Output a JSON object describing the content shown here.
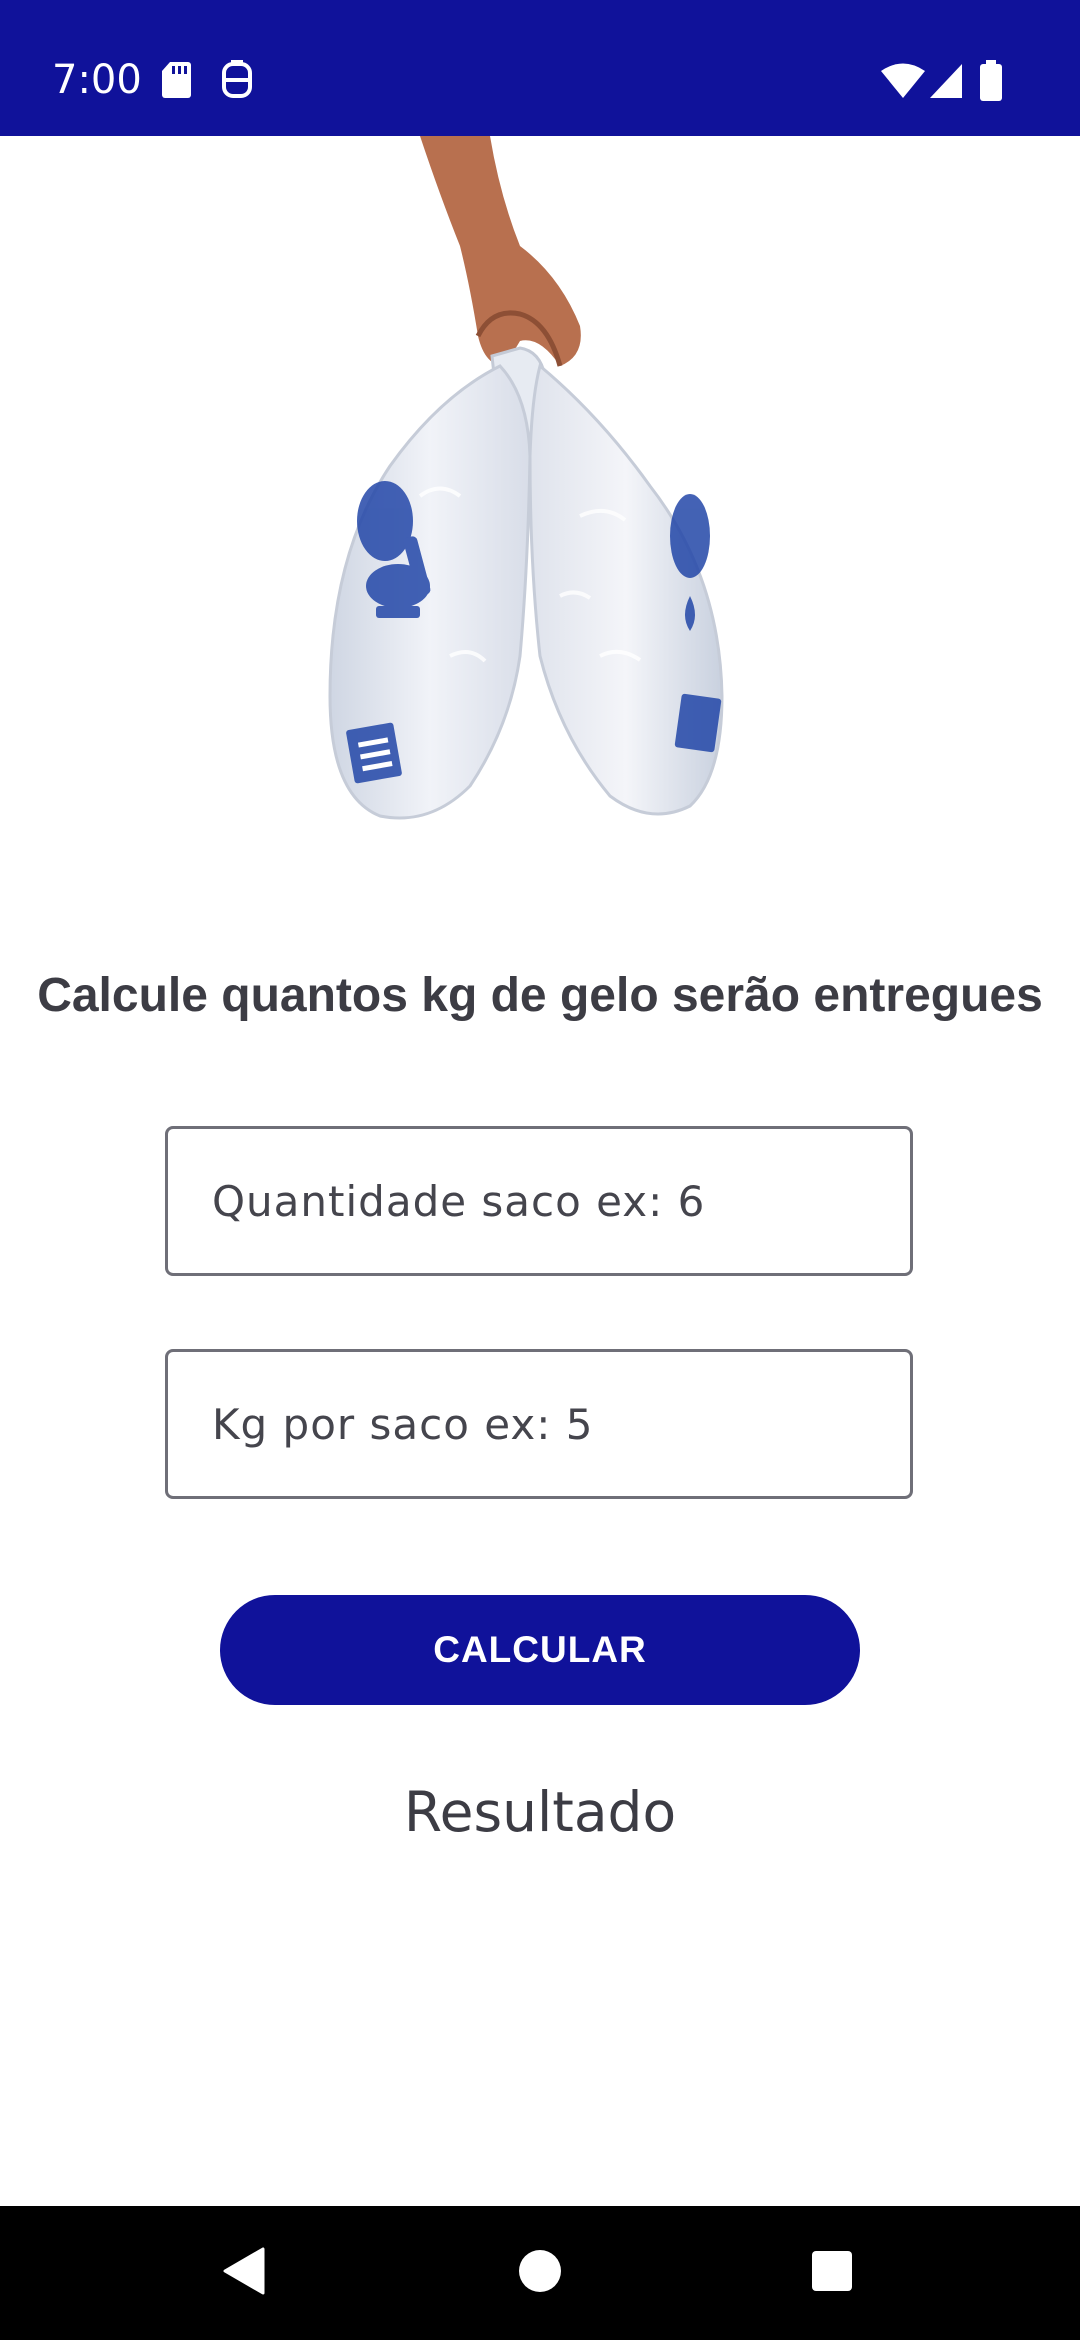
{
  "status_bar": {
    "time": "7:00",
    "background_color": "#10129a",
    "left_icons": [
      "sd-card-icon",
      "sim-card-icon"
    ],
    "right_icons": [
      "wifi-icon",
      "cell-signal-icon",
      "battery-icon"
    ]
  },
  "hero": {
    "image": "ice-bags-held-by-hand"
  },
  "page": {
    "title": "Calcule quantos kg de gelo serão entregues"
  },
  "form": {
    "quantity_placeholder": "Quantidade saco ex: 6",
    "kg_placeholder": "Kg por saco ex: 5",
    "calculate_label": "CALCULAR",
    "result_label": "Resultado"
  },
  "colors": {
    "accent": "#10129a",
    "text": "#3c3c44",
    "field_border": "#6f6f78"
  },
  "nav_bar": {
    "buttons": [
      "back-icon",
      "home-icon",
      "recents-icon"
    ]
  }
}
